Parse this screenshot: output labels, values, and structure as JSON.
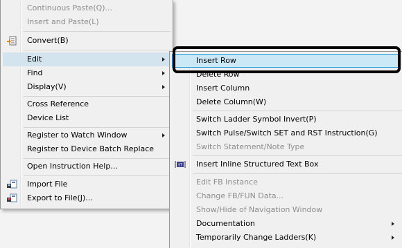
{
  "main_menu": {
    "items": [
      {
        "label": "Continuous Paste(Q)..."
      },
      {
        "label": "Insert and Paste(L)"
      },
      {
        "label": "Convert(B)",
        "icon": "convert-icon"
      },
      {
        "label": "Edit"
      },
      {
        "label": "Find"
      },
      {
        "label": "Display(V)"
      },
      {
        "label": "Cross Reference"
      },
      {
        "label": "Device List"
      },
      {
        "label": "Register to Watch Window"
      },
      {
        "label": "Register to Device Batch Replace"
      },
      {
        "label": "Open Instruction Help..."
      },
      {
        "label": "Import File",
        "icon": "import-file-icon"
      },
      {
        "label": "Export to File(J)...",
        "icon": "export-file-icon"
      }
    ]
  },
  "sub_menu": {
    "items": [
      {
        "label": "Insert Row"
      },
      {
        "label": "Delete Row"
      },
      {
        "label": "Insert Column"
      },
      {
        "label": "Delete Column(W)"
      },
      {
        "label": "Switch Ladder Symbol Invert(P)"
      },
      {
        "label": "Switch Pulse/Switch SET and RST Instruction(G)"
      },
      {
        "label": "Switch Statement/Note Type"
      },
      {
        "label": "Insert Inline Structured Text Box",
        "icon": "inline-st-icon"
      },
      {
        "label": "Edit FB Instance"
      },
      {
        "label": "Change FB/FUN Data..."
      },
      {
        "label": "Show/Hide of Navigation Window"
      },
      {
        "label": "Documentation"
      },
      {
        "label": "Temporarily Change Ladders(K)"
      }
    ]
  },
  "colors": {
    "menu_bg": "#f0f0f0",
    "highlight_bg": "#cbe8f6",
    "highlight_border": "#26a0da",
    "disabled_text": "#8d8d8d",
    "callout_border": "#000000"
  }
}
